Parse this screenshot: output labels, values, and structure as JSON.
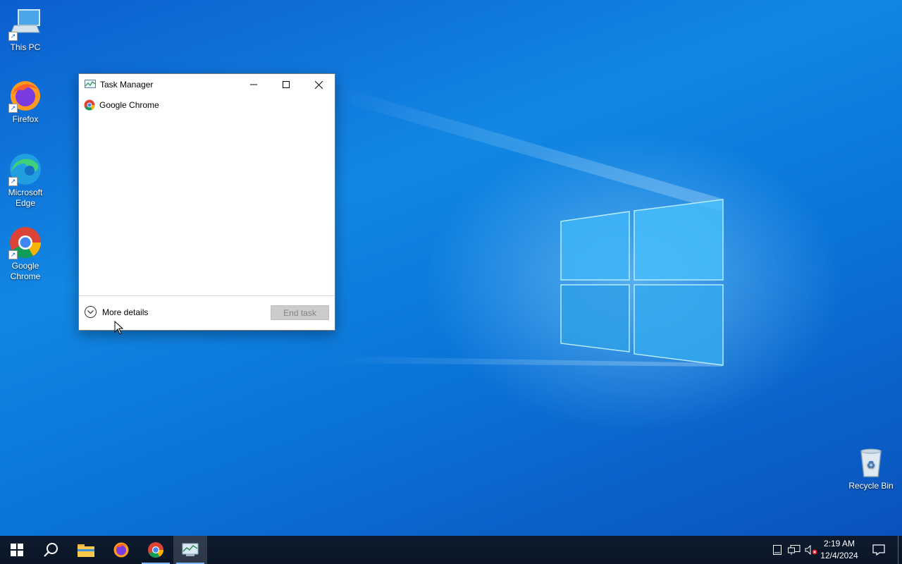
{
  "desktop": {
    "icons": [
      {
        "label_line1": "This PC",
        "label_line2": ""
      },
      {
        "label_line1": "Firefox",
        "label_line2": ""
      },
      {
        "label_line1": "Microsoft",
        "label_line2": "Edge"
      },
      {
        "label_line1": "Google",
        "label_line2": "Chrome"
      },
      {
        "label_line1": "Recycle Bin",
        "label_line2": ""
      }
    ]
  },
  "window": {
    "title": "Task Manager",
    "processes": [
      {
        "name": "Google Chrome",
        "icon": "chrome-icon"
      }
    ],
    "more_details_label": "More details",
    "end_task_label": "End task"
  },
  "taskbar": {
    "buttons": [
      "start-icon",
      "search-icon",
      "file-explorer-icon",
      "firefox-icon",
      "chrome-icon",
      "task-manager-icon"
    ],
    "clock": {
      "time": "2:19 AM",
      "date": "12/4/2024"
    }
  },
  "colors": {
    "desktop_bg": "#0a74d8",
    "taskbar_bg": "#0d1b2e",
    "end_task_disabled": "#cccccc"
  }
}
